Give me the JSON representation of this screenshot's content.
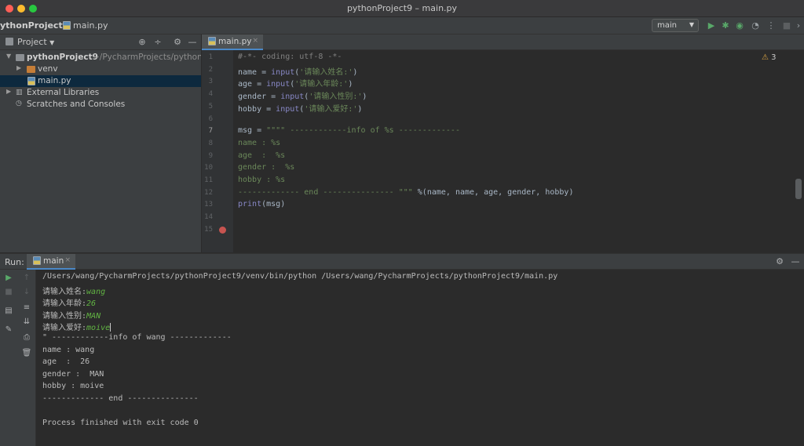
{
  "window": {
    "title": "pythonProject9 – main.py"
  },
  "navbar": {
    "project": "ythonProject9",
    "file": "main.py",
    "run_config": "main"
  },
  "project_panel": {
    "title": "Project",
    "items": [
      {
        "label": "pythonProject9",
        "path": "~/PycharmProjects/pythonProjectg"
      },
      {
        "label": "venv"
      },
      {
        "label": "main.py"
      },
      {
        "label": "External Libraries"
      },
      {
        "label": "Scratches and Consoles"
      }
    ]
  },
  "editor": {
    "tab": "main.py",
    "warnings": "3",
    "line_numbers": [
      "1",
      "2",
      "3",
      "4",
      "5",
      "6",
      "7",
      "8",
      "9",
      "10",
      "11",
      "12",
      "13",
      "14",
      "15"
    ],
    "lines": [
      {
        "n": "1",
        "parts": [
          {
            "t": "#-*- coding: utf-8 -*-",
            "c": "cmt"
          }
        ]
      },
      {
        "n": "2",
        "parts": [
          {
            "t": "name = ",
            "c": ""
          },
          {
            "t": "input",
            "c": "kw-fn"
          },
          {
            "t": "(",
            "c": ""
          },
          {
            "t": "'请输入姓名:'",
            "c": "str"
          },
          {
            "t": ")",
            "c": ""
          }
        ]
      },
      {
        "n": "3",
        "parts": [
          {
            "t": "age = ",
            "c": ""
          },
          {
            "t": "input",
            "c": "kw-fn"
          },
          {
            "t": "(",
            "c": ""
          },
          {
            "t": "'请输入年龄:'",
            "c": "str"
          },
          {
            "t": ")",
            "c": ""
          }
        ]
      },
      {
        "n": "4",
        "parts": [
          {
            "t": "gender = ",
            "c": ""
          },
          {
            "t": "input",
            "c": "kw-fn"
          },
          {
            "t": "(",
            "c": ""
          },
          {
            "t": "'请输入性别:'",
            "c": "str"
          },
          {
            "t": ")",
            "c": ""
          }
        ]
      },
      {
        "n": "5",
        "parts": [
          {
            "t": "hobby = ",
            "c": ""
          },
          {
            "t": "input",
            "c": "kw-fn"
          },
          {
            "t": "(",
            "c": ""
          },
          {
            "t": "'请输入爱好:'",
            "c": "str"
          },
          {
            "t": ")",
            "c": ""
          }
        ]
      },
      {
        "n": "6",
        "parts": []
      },
      {
        "n": "7",
        "parts": [
          {
            "t": "msg = ",
            "c": ""
          },
          {
            "t": "\"\"\"\" ------------info of %s -------------",
            "c": "str"
          }
        ]
      },
      {
        "n": "8",
        "parts": [
          {
            "t": "name : %s",
            "c": "str"
          }
        ]
      },
      {
        "n": "9",
        "parts": [
          {
            "t": "age  :  %s",
            "c": "str"
          }
        ]
      },
      {
        "n": "10",
        "parts": [
          {
            "t": "gender :  %s",
            "c": "str"
          }
        ]
      },
      {
        "n": "11",
        "parts": [
          {
            "t": "hobby : %s",
            "c": "str"
          }
        ]
      },
      {
        "n": "12",
        "parts": [
          {
            "t": "------------- end --------------- \"\"\"",
            "c": "str"
          },
          {
            "t": " %(name, name, age, gender, hobby)",
            "c": ""
          }
        ]
      },
      {
        "n": "13",
        "parts": [
          {
            "t": "print",
            "c": "kw-fn"
          },
          {
            "t": "(msg)",
            "c": ""
          }
        ]
      },
      {
        "n": "14",
        "parts": []
      },
      {
        "n": "15",
        "parts": []
      }
    ]
  },
  "run_panel": {
    "label": "Run:",
    "tab": "main",
    "output": [
      {
        "prompt": "/Users/wang/PycharmProjects/pythonProject9/venv/bin/python /Users/wang/PycharmProjects/pythonProject9/main.py",
        "input": ""
      },
      {
        "prompt": "请输入姓名:",
        "input": "wang"
      },
      {
        "prompt": "请输入年龄:",
        "input": "26"
      },
      {
        "prompt": "请输入性别:",
        "input": "MAN"
      },
      {
        "prompt": "请输入爱好:",
        "input": "moive"
      },
      {
        "prompt": "\" ------------info of wang -------------",
        "input": ""
      },
      {
        "prompt": "name : wang",
        "input": ""
      },
      {
        "prompt": "age  :  26",
        "input": ""
      },
      {
        "prompt": "gender :  MAN",
        "input": ""
      },
      {
        "prompt": "hobby : moive",
        "input": ""
      },
      {
        "prompt": "------------- end ---------------",
        "input": ""
      },
      {
        "prompt": "",
        "input": ""
      },
      {
        "prompt": "Process finished with exit code 0",
        "input": ""
      }
    ]
  },
  "colors": {
    "close": "#ff5f57",
    "minimize": "#febc2e",
    "maximize": "#28c840",
    "run_green": "#59a869",
    "breakpoint": "#c75450"
  }
}
